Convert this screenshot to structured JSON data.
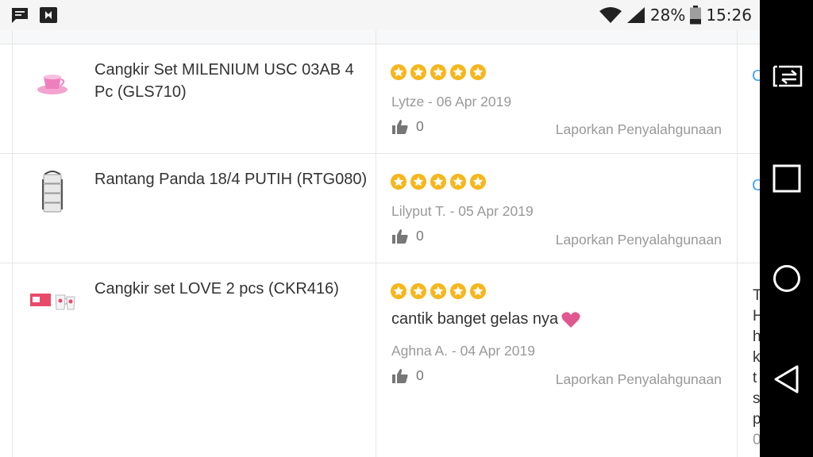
{
  "status_bar": {
    "notif_icons": [
      "message-icon",
      "cast-app-icon"
    ],
    "wifi_icon": "wifi-icon",
    "signal_icon": "signal-icon",
    "battery_percent": "28%",
    "battery_icon": "battery-icon",
    "time": "15:26"
  },
  "colors": {
    "star": "#f6b61c",
    "link": "#42a5f5",
    "heart": "#e05890",
    "muted": "#999999"
  },
  "reviews": [
    {
      "product_name": "Cangkir Set MILENIUM USC 03AB 4 Pc (GLS710)",
      "rating": 5,
      "review_text": "",
      "author_date": "Lytze - 06 Apr 2019",
      "like_count": "0",
      "report_label": "Laporkan Penyalahgunaan",
      "right_col_partial": "C"
    },
    {
      "product_name": "Rantang Panda 18/4 PUTIH (RTG080)",
      "rating": 5,
      "review_text": "",
      "author_date": "Lilyput T. - 05 Apr 2019",
      "like_count": "0",
      "report_label": "Laporkan Penyalahgunaan",
      "right_col_partial": "C"
    },
    {
      "product_name": "Cangkir set LOVE 2 pcs (CKR416)",
      "rating": 5,
      "review_text": "cantik banget gelas nya",
      "author_date": "Aghna A. - 04 Apr 2019",
      "like_count": "0",
      "report_label": "Laporkan Penyalahgunaan",
      "right_col_partial_lines": [
        "T",
        "H",
        "h",
        "k",
        "t",
        "s",
        "p",
        "0"
      ]
    }
  ],
  "nav_bar": [
    "screen-share-icon",
    "recent-apps-icon",
    "home-icon",
    "back-icon"
  ]
}
